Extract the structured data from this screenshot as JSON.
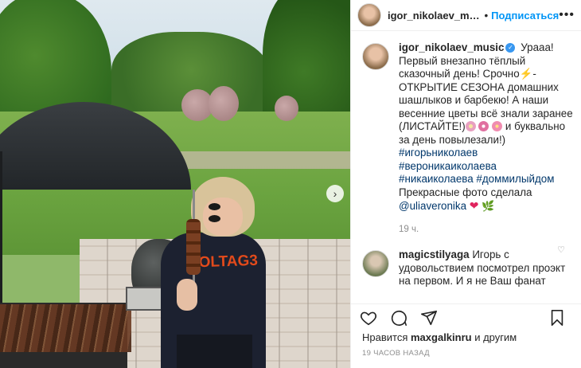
{
  "header": {
    "username": "igor_nikolaev_music",
    "separator": "•",
    "follow_label": "Подписаться",
    "more_icon": "more-dots-icon",
    "more_glyph": "•••"
  },
  "caption": {
    "username": "igor_nikolaev_music",
    "verified_glyph": "✓",
    "text_1": "Урааа! Первый внезапно тёплый сказочный день! Срочно",
    "bolt": "⚡",
    "text_2": "- ОТКРЫТИЕ СЕЗОНА домашних шашлыков и барбекю! А наши весенние цветы всё знали заранее (ЛИСТАЙТЕ!)",
    "text_3": "и буквально за день повылезали!)",
    "hashtags": [
      "#игорьниколаев",
      "#вероникаиколаева",
      "#никаиколаева",
      "#доммилыйдом"
    ],
    "credit_text": "Прекрасные фото сделала",
    "credit_mention": "@uliaveronika",
    "heart": "❤",
    "leaf": "🌿",
    "time": "19 ч."
  },
  "comment": {
    "username": "magicstilyaga",
    "text": "Игорь с удовольствием посмотрел проэкт на первом. И я не Ваш фанат",
    "like_glyph": "♡"
  },
  "photo": {
    "shirt_text": "VOLTAG3",
    "next_glyph": "›"
  },
  "actions": {
    "like_icon": "heart-outline-icon",
    "comment_icon": "comment-bubble-icon",
    "share_icon": "paper-plane-icon",
    "save_icon": "bookmark-icon"
  },
  "likes": {
    "prefix": "Нравится",
    "user": "maxgalkinru",
    "suffix": "и другим"
  },
  "post_time": "19 ЧАСОВ НАЗАД",
  "colors": {
    "follow": "#0095f6",
    "tag": "#00376b",
    "muted": "#8e8e8e"
  }
}
